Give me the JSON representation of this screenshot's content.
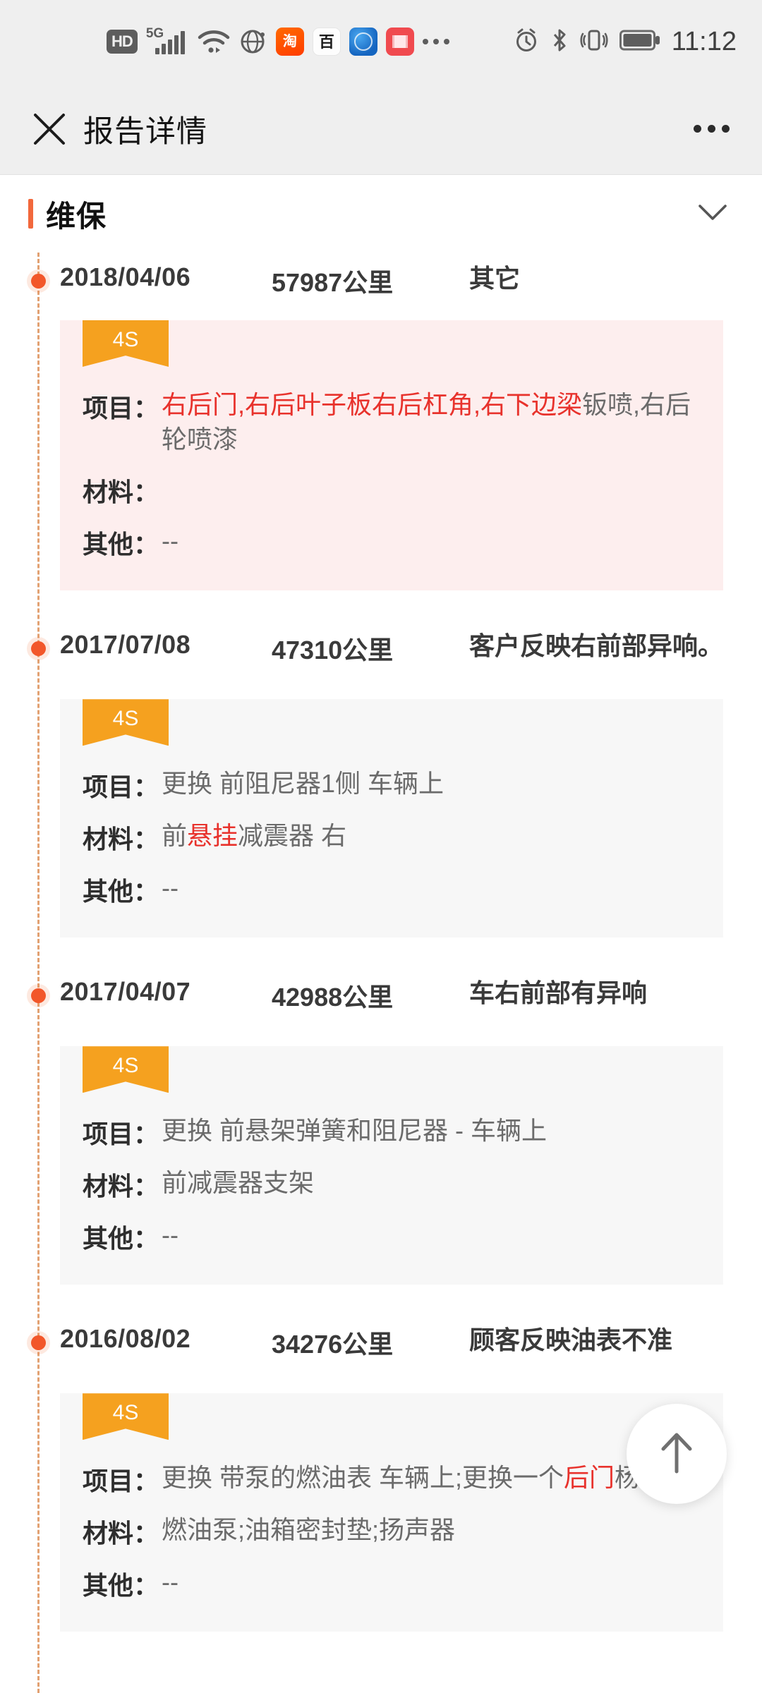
{
  "status_bar": {
    "icons": [
      "hd-icon",
      "5g-signal-icon",
      "wifi-icon",
      "vpn-globe-icon",
      "taobao-app-icon",
      "baidu-app-icon",
      "browser-app-icon",
      "reader-app-icon",
      "more-icons-icon",
      "alarm-icon",
      "bluetooth-icon",
      "vibrate-icon",
      "battery-icon"
    ],
    "hd_label": "HD",
    "network_label": "5G",
    "taobao_label": "淘",
    "baidu_label": "百",
    "time": "11:12"
  },
  "nav": {
    "close_icon": "close-icon",
    "title": "报告详情",
    "more_icon": "more-options-icon"
  },
  "section": {
    "title": "维保",
    "accent_color": "#f2683c",
    "chevron_icon": "chevron-down-icon",
    "expanded": true
  },
  "labels": {
    "project": "项目：",
    "material": "材料：",
    "other": "其他：",
    "tag": "4S"
  },
  "records": [
    {
      "date": "2018/04/06",
      "mileage": "57987公里",
      "description": "其它",
      "tag": "4S",
      "highlight": true,
      "project_pre": "",
      "project_hl": "右后门,右后叶子板右后杠角,右下边梁",
      "project_post": "钣喷,右后轮喷漆",
      "material_pre": "",
      "material_hl": "",
      "material_post": "",
      "other": "--"
    },
    {
      "date": "2017/07/08",
      "mileage": "47310公里",
      "description": "客户反映右前部异响。",
      "tag": "4S",
      "highlight": false,
      "project_pre": "更换 前阻尼器1侧 车辆上",
      "project_hl": "",
      "project_post": "",
      "material_pre": "前",
      "material_hl": "悬挂",
      "material_post": "减震器 右",
      "other": "--"
    },
    {
      "date": "2017/04/07",
      "mileage": "42988公里",
      "description": "车右前部有异响",
      "tag": "4S",
      "highlight": false,
      "project_pre": "更换 前悬架弹簧和阻尼器 - 车辆上",
      "project_hl": "",
      "project_post": "",
      "material_pre": "前减震器支架",
      "material_hl": "",
      "material_post": "",
      "other": "--"
    },
    {
      "date": "2016/08/02",
      "mileage": "34276公里",
      "description": "顾客反映油表不准",
      "tag": "4S",
      "highlight": false,
      "project_pre": "更换 带泵的燃油表 车辆上;更换一个",
      "project_hl": "后门",
      "project_post": "杨声器",
      "material_pre": "燃油泵;油箱密封垫;扬声器",
      "material_hl": "",
      "material_post": "",
      "other": "--"
    }
  ],
  "fab": {
    "icon": "arrow-up-icon",
    "name": "back-to-top"
  }
}
